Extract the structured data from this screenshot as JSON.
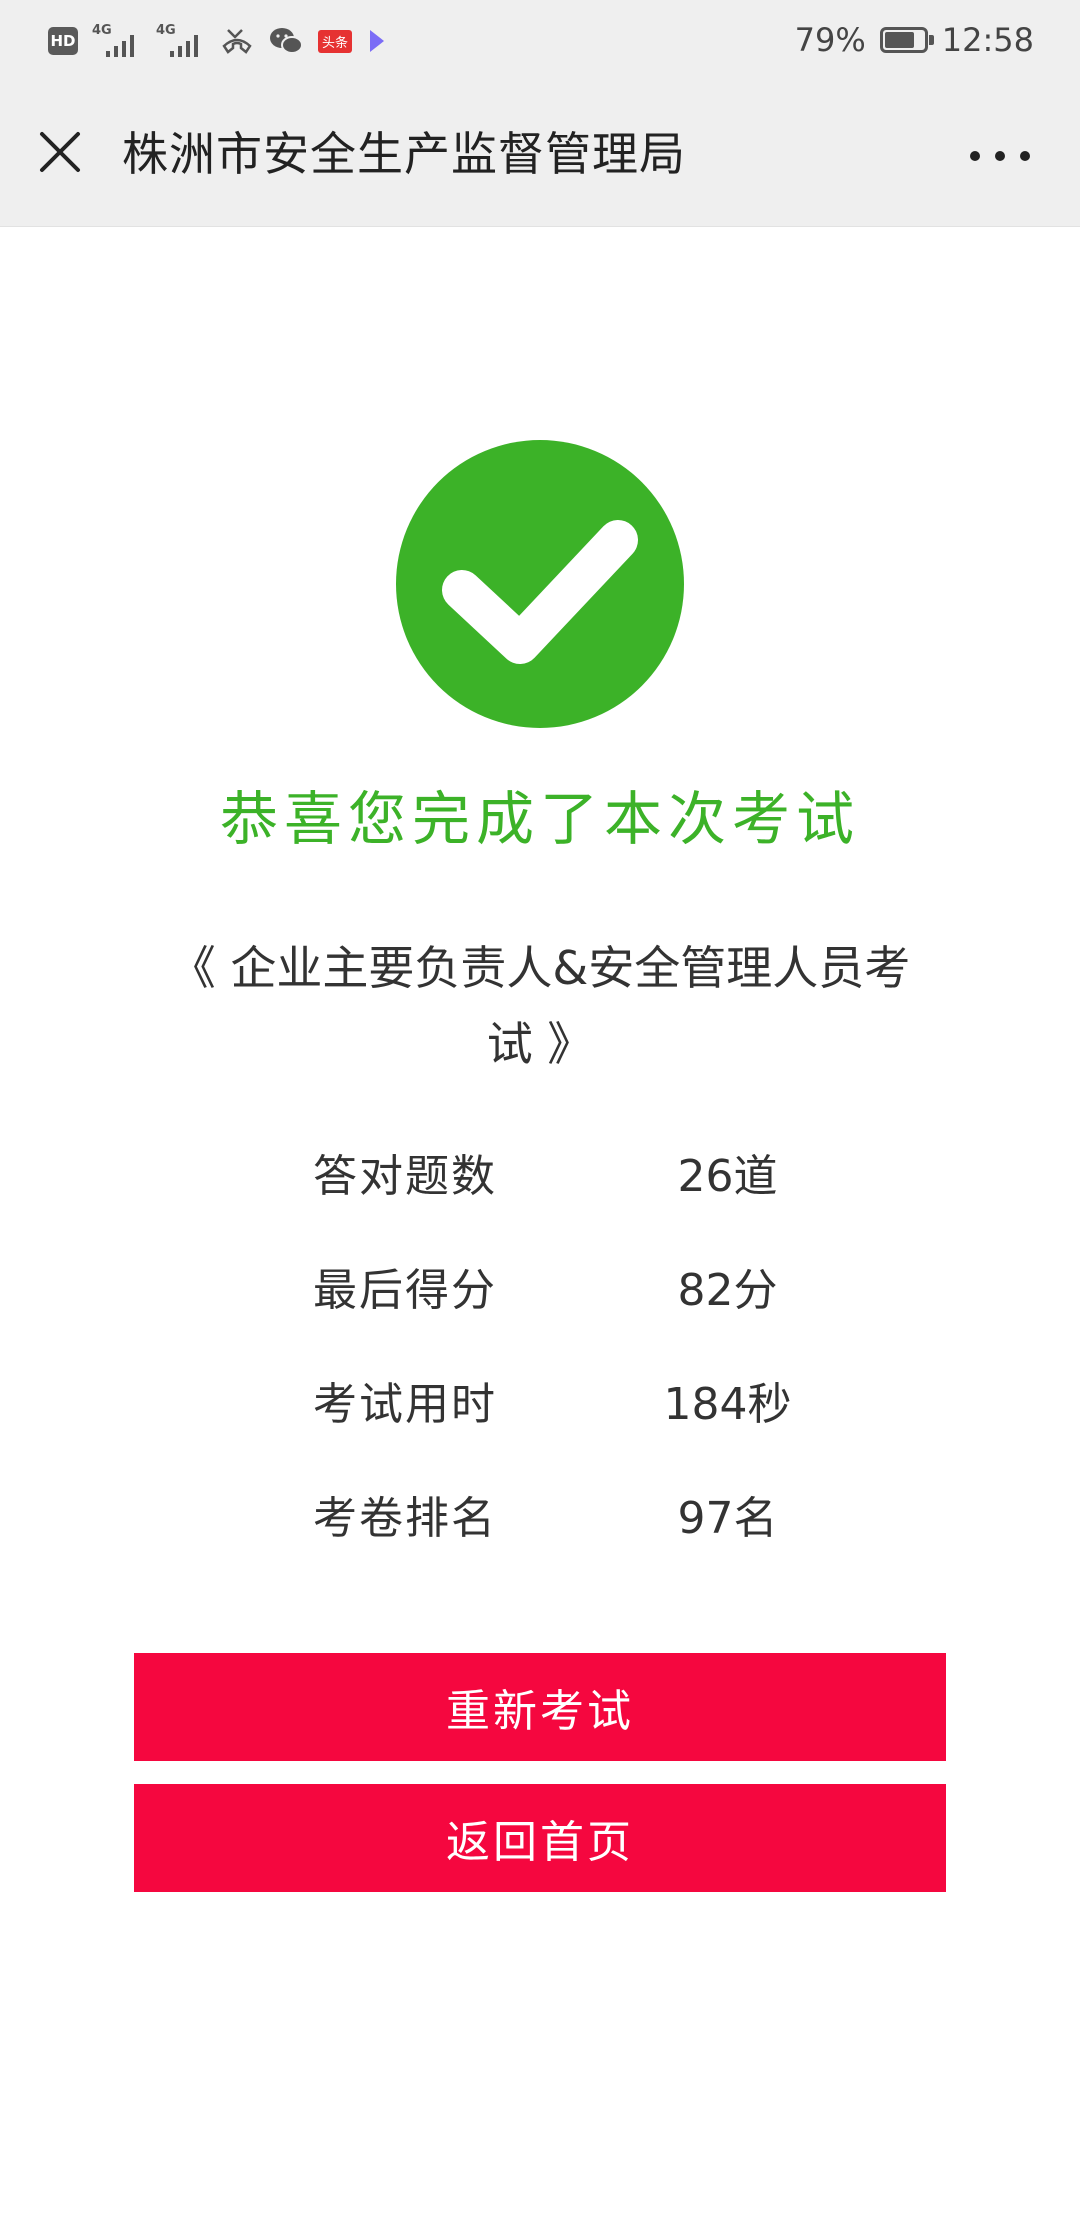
{
  "status_bar": {
    "hd": "HD",
    "network1": "4G",
    "network2": "4G",
    "app_badge": "头条",
    "battery_percent": "79%",
    "battery_level": 0.79,
    "time": "12:58"
  },
  "nav": {
    "title": "株洲市安全生产监督管理局"
  },
  "result": {
    "congrats": "恭喜您完成了本次考试",
    "exam_title": "《 企业主要负责人&安全管理人员考试 》",
    "stats": [
      {
        "label": "答对题数",
        "value": "26道"
      },
      {
        "label": "最后得分",
        "value": "82分"
      },
      {
        "label": "考试用时",
        "value": "184秒"
      },
      {
        "label": "考卷排名",
        "value": "97名"
      }
    ]
  },
  "buttons": {
    "retry": "重新考试",
    "home": "返回首页"
  },
  "colors": {
    "success_green": "#3cb228",
    "button_red": "#f5073f",
    "bar_gray": "#efefef"
  },
  "icons": {
    "close": "close-icon",
    "more": "more-dots-icon",
    "success": "checkmark-circle-icon"
  }
}
